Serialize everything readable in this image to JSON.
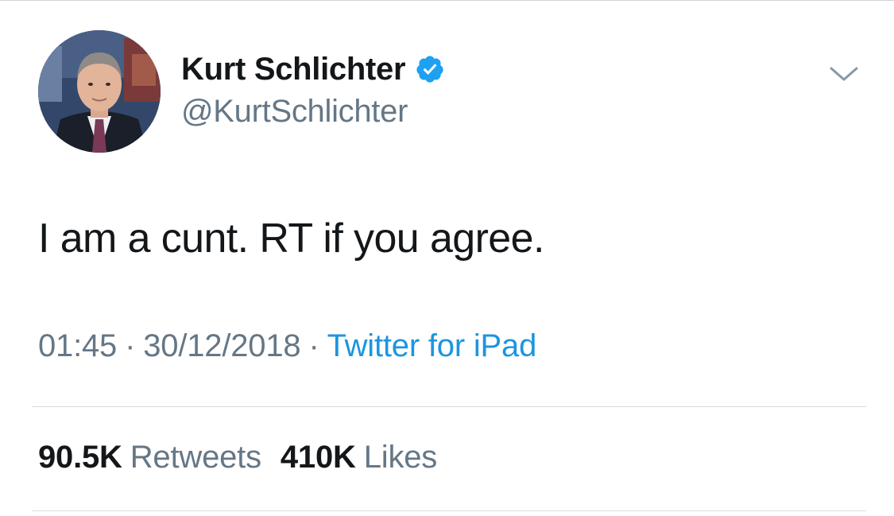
{
  "tweet": {
    "author": {
      "display_name": "Kurt Schlichter",
      "handle": "@KurtSchlichter",
      "verified": true
    },
    "text": "I am a cunt. RT if you agree.",
    "time": "01:45",
    "date": "30/12/2018",
    "separator": "·",
    "source": "Twitter for iPad",
    "stats": {
      "retweets_count": "90.5K",
      "retweets_label": "Retweets",
      "likes_count": "410K",
      "likes_label": "Likes"
    }
  },
  "icons": {
    "verified": "verified-badge-icon",
    "menu": "chevron-down-icon"
  },
  "colors": {
    "text_primary": "#14171a",
    "text_secondary": "#657786",
    "link": "#1b95e0",
    "verified": "#1da1f2"
  }
}
